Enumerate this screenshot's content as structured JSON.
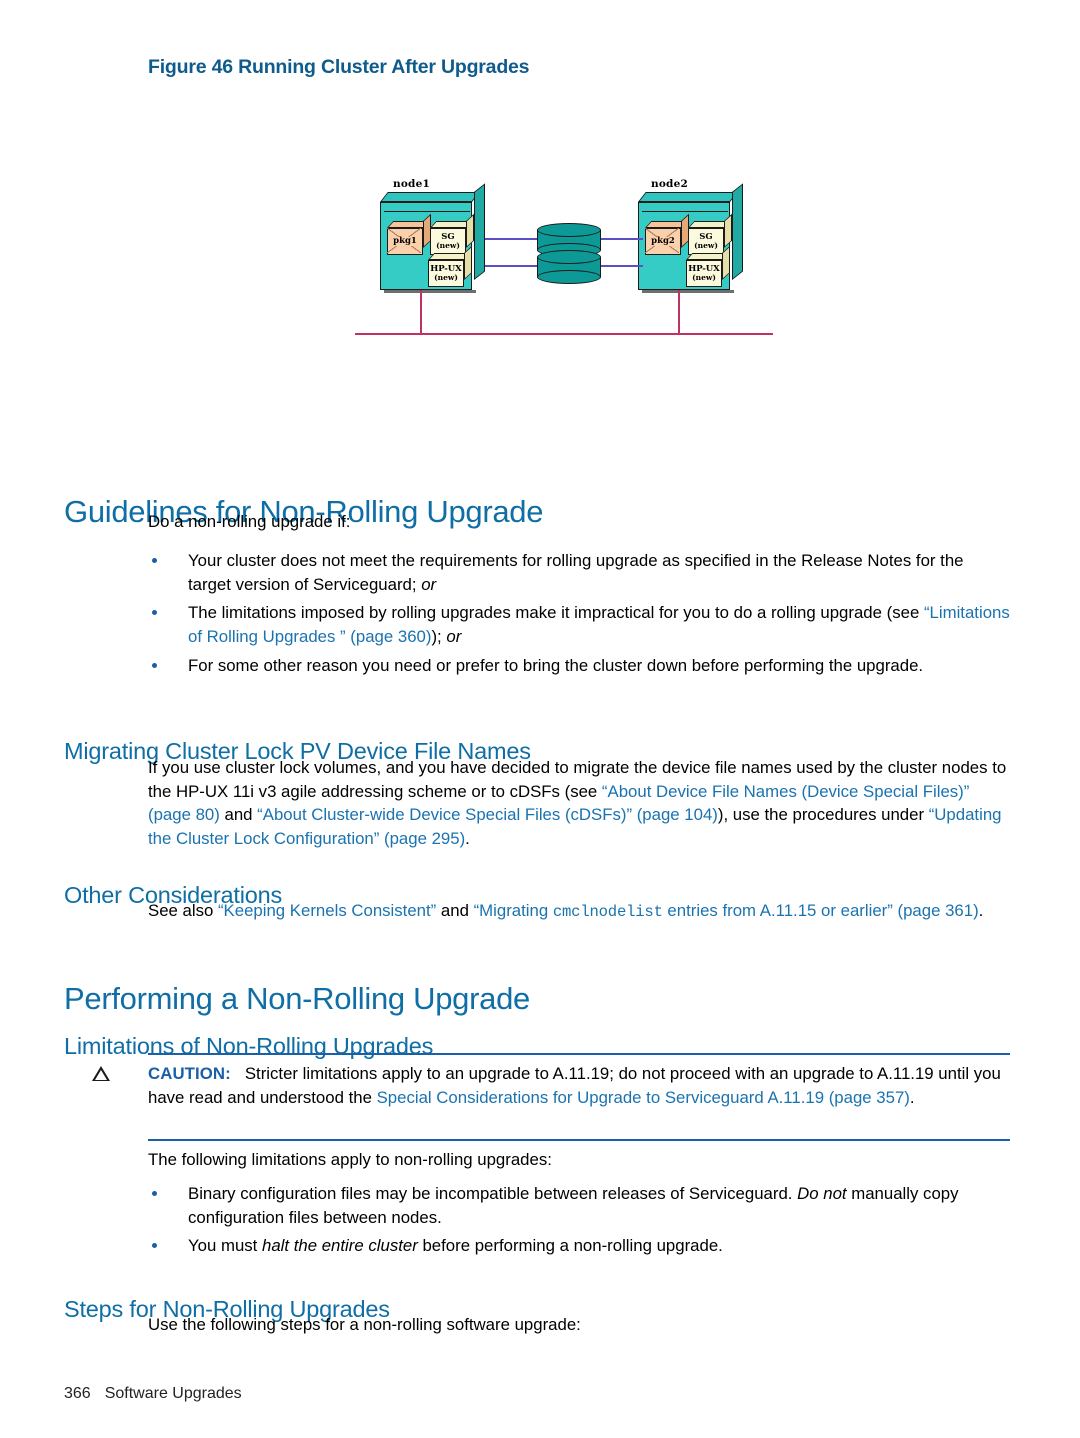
{
  "figure": {
    "caption": "Figure 46 Running Cluster After Upgrades",
    "nodes": [
      {
        "label": "node1",
        "package": "pkg1",
        "boxes": [
          {
            "line1": "SG",
            "line2": "(new)"
          },
          {
            "line1": "HP-UX",
            "line2": "(new)"
          }
        ]
      },
      {
        "label": "node2",
        "package": "pkg2",
        "boxes": [
          {
            "line1": "SG",
            "line2": "(new)"
          },
          {
            "line1": "HP-UX",
            "line2": "(new)"
          }
        ]
      }
    ],
    "disk_count": 2,
    "colors": {
      "node": "#35ccc6",
      "disk": "#0d9a96",
      "package": "#fbd0ad",
      "software_box": "#fcfade",
      "wire": "#5b4fc4",
      "network": "#c0325f"
    }
  },
  "sections": {
    "guidelines": {
      "heading": "Guidelines for Non-Rolling Upgrade",
      "intro": "Do a non-rolling upgrade if:",
      "bullets": [
        {
          "parts": [
            {
              "t": "Your cluster does not meet the requirements for rolling upgrade as specified in the Release Notes for the target version of Serviceguard; ",
              "s": "plain"
            },
            {
              "t": "or",
              "s": "italic"
            }
          ]
        },
        {
          "parts": [
            {
              "t": "The limitations imposed by rolling upgrades make it impractical for you to do a rolling upgrade (see ",
              "s": "plain"
            },
            {
              "t": "“Limitations of Rolling Upgrades ” (page 360)",
              "s": "link"
            },
            {
              "t": "); ",
              "s": "plain"
            },
            {
              "t": "or",
              "s": "italic"
            }
          ]
        },
        {
          "parts": [
            {
              "t": "For some other reason you need or prefer to bring the cluster down before performing the upgrade.",
              "s": "plain"
            }
          ]
        }
      ]
    },
    "migrating": {
      "heading": "Migrating Cluster Lock PV Device File Names",
      "paragraph": [
        {
          "t": "If you use cluster lock volumes, and you have decided to migrate the device file names used by the cluster nodes to the HP-UX 11i v3 agile addressing scheme or to cDSFs (see ",
          "s": "plain"
        },
        {
          "t": "“About Device File Names (Device Special Files)” (page 80)",
          "s": "link"
        },
        {
          "t": " and ",
          "s": "plain"
        },
        {
          "t": "“About Cluster-wide Device Special Files (cDSFs)” (page 104)",
          "s": "link"
        },
        {
          "t": "), use the procedures under ",
          "s": "plain"
        },
        {
          "t": "“Updating the Cluster Lock Configuration” (page 295)",
          "s": "link"
        },
        {
          "t": ".",
          "s": "plain"
        }
      ]
    },
    "other_considerations": {
      "heading": "Other Considerations",
      "paragraph": [
        {
          "t": "See also ",
          "s": "plain"
        },
        {
          "t": "“Keeping Kernels Consistent”",
          "s": "link"
        },
        {
          "t": " and ",
          "s": "plain"
        },
        {
          "t": "“Migrating ",
          "s": "link"
        },
        {
          "t": "cmclnodelist",
          "s": "link-mono"
        },
        {
          "t": " entries from A.11.15 or earlier” (page 361)",
          "s": "link"
        },
        {
          "t": ".",
          "s": "plain"
        }
      ]
    },
    "performing": {
      "heading": "Performing a Non-Rolling Upgrade"
    },
    "limitations": {
      "heading": "Limitations of Non-Rolling Upgrades",
      "caution": {
        "icon": "caution-triangle-icon",
        "label": "CAUTION:",
        "parts": [
          {
            "t": "Stricter limitations apply to an upgrade to A.11.19; do not proceed with an upgrade to A.11.19 until you have read and understood the ",
            "s": "plain"
          },
          {
            "t": "Special Considerations for Upgrade to Serviceguard A.11.19 (page 357)",
            "s": "link"
          },
          {
            "t": ".",
            "s": "plain"
          }
        ]
      },
      "intro": "The following limitations apply to non-rolling upgrades:",
      "bullets": [
        {
          "parts": [
            {
              "t": "Binary configuration files may be incompatible between releases of Serviceguard. ",
              "s": "plain"
            },
            {
              "t": "Do not",
              "s": "italic"
            },
            {
              "t": " manually copy configuration files between nodes.",
              "s": "plain"
            }
          ]
        },
        {
          "parts": [
            {
              "t": "You must ",
              "s": "plain"
            },
            {
              "t": "halt the entire cluster",
              "s": "italic"
            },
            {
              "t": " before performing a non-rolling upgrade.",
              "s": "plain"
            }
          ]
        }
      ]
    },
    "steps": {
      "heading": "Steps for Non-Rolling Upgrades",
      "intro": "Use the following steps for a non-rolling software upgrade:"
    }
  },
  "footer": {
    "page_number": "366",
    "chapter": "Software Upgrades"
  }
}
